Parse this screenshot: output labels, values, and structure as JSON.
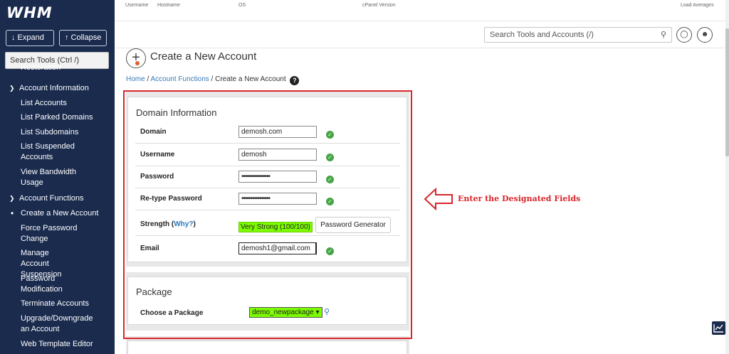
{
  "brand": {
    "logo": "WHM"
  },
  "sidebar": {
    "expand_label": "↓ Expand",
    "collapse_label": "↑ Collapse",
    "search_placeholder": "Search Tools (Ctrl /)",
    "cut_item": "Restoration",
    "account_info": "Account Information",
    "items_account_info": [
      "List Accounts",
      "List Parked Domains",
      "List Subdomains",
      "List Suspended Accounts",
      "View Bandwidth Usage"
    ],
    "account_functions": "Account Functions",
    "items_account_functions": [
      "Create a New Account",
      "Force Password Change",
      "Manage Account Suspension",
      "Password Modification",
      "Terminate Accounts",
      "Upgrade/Downgrade an Account",
      "Web Template Editor"
    ]
  },
  "topinfo": {
    "username": "Username",
    "hostname": "Hostname",
    "os": "OS",
    "cpanel": "cPanel Version",
    "load": "Load Averages"
  },
  "header": {
    "search_placeholder": "Search Tools and Accounts (/)"
  },
  "page": {
    "title": "Create a New Account",
    "breadcrumb": {
      "home": "Home",
      "section": "Account Functions",
      "current": "Create a New Account",
      "sep": "/"
    }
  },
  "domain_info": {
    "title": "Domain Information",
    "domain_label": "Domain",
    "domain_value": "demosh.com",
    "username_label": "Username",
    "username_value": "demosh",
    "password_label": "Password",
    "password_value": "••••••••••••••••",
    "retype_label": "Re-type Password",
    "retype_value": "••••••••••••••••",
    "strength_label": "Strength",
    "why_label": "Why?",
    "strength_value": "Very Strong (100/100)",
    "generator_label": "Password Generator",
    "email_label": "Email",
    "email_value": "demosh1@gmail.com"
  },
  "package": {
    "title": "Package",
    "choose_label": "Choose a Package",
    "selected": "demo_newpackage"
  },
  "annotation": {
    "text": "Enter the Designated Fields",
    "color": "#d9262c"
  },
  "colors": {
    "sidebar_bg": "#1a2b4e",
    "link": "#3a7ab8",
    "success": "#44a544",
    "highlight": "#7cfc00"
  }
}
